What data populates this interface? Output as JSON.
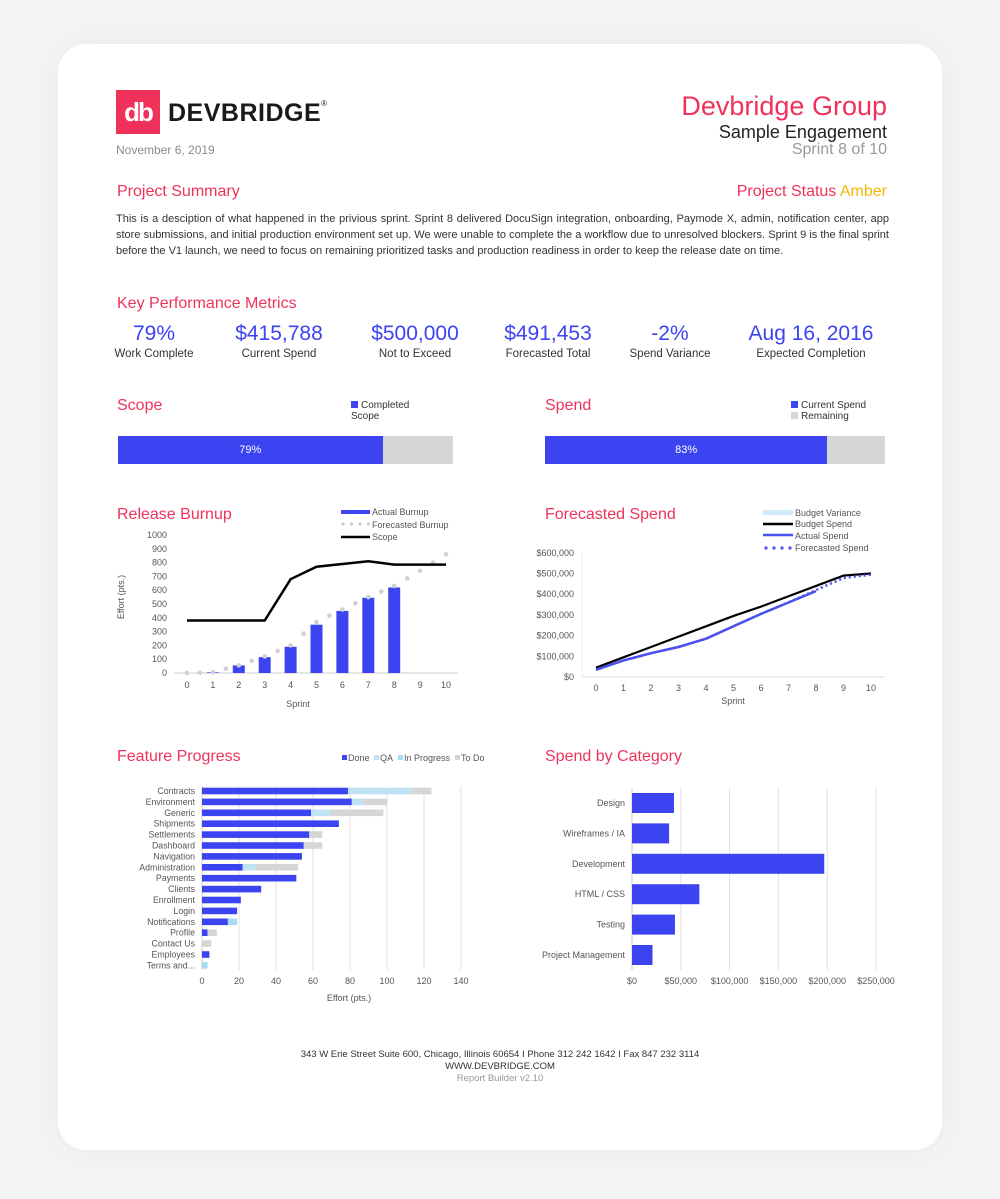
{
  "colors": {
    "brand": "#f0325a",
    "accent": "#3b44f0",
    "status_amber": "#f5b800",
    "remaining": "#d6d6d6",
    "qa": "#bfe3f5",
    "in_progress": "#a6dcf0"
  },
  "header": {
    "logo_mark": "db",
    "logo_text": "DEVBRIDGE",
    "date": "November 6, 2019",
    "company": "Devbridge Group",
    "engagement": "Sample Engagement",
    "sprint": "Sprint 8 of 10"
  },
  "summary": {
    "title": "Project Summary",
    "status_label": "Project Status",
    "status_value": "Amber",
    "text": "This is a desciption of what happened in the privious sprint. Sprint 8 delivered DocuSign integration, onboarding,  Paymode X, admin, notification center, app store submissions, and initial production environment set up. We were unable to complete the a workflow due to unresolved blockers. Sprint 9 is the final sprint before the V1 launch, we need to focus on remaining prioritized tasks and production readiness in order to keep the release date on time."
  },
  "kpi": {
    "title": "Key Performance Metrics",
    "items": [
      {
        "value": "79%",
        "label": "Work Complete"
      },
      {
        "value": "$415,788",
        "label": "Current Spend"
      },
      {
        "value": "$500,000",
        "label": "Not to Exceed"
      },
      {
        "value": "$491,453",
        "label": "Forecasted Total"
      },
      {
        "value": "-2%",
        "label": "Spend Variance"
      },
      {
        "value": "Aug 16, 2016",
        "label": "Expected Completion"
      }
    ]
  },
  "scope": {
    "title": "Scope",
    "legend": [
      "Completed",
      "Scope"
    ],
    "percent": 79,
    "label": "79%"
  },
  "spend": {
    "title": "Spend",
    "legend": [
      "Current Spend",
      "Remaining"
    ],
    "percent": 83,
    "label": "83%"
  },
  "chart_data": [
    {
      "id": "burnup",
      "type": "bar+line",
      "title": "Release Burnup",
      "xlabel": "Sprint",
      "ylabel": "Effort (pts.)",
      "x": [
        0,
        1,
        2,
        3,
        4,
        5,
        6,
        7,
        8,
        9,
        10
      ],
      "ylim": [
        0,
        1000
      ],
      "yticks": [
        0,
        100,
        200,
        300,
        400,
        500,
        600,
        700,
        800,
        900,
        1000
      ],
      "series": [
        {
          "name": "Actual Burnup",
          "kind": "bar",
          "values": [
            0,
            5,
            55,
            115,
            190,
            350,
            450,
            545,
            620,
            null,
            null
          ]
        },
        {
          "name": "Forecasted Burnup",
          "kind": "dotted",
          "values": [
            0,
            5,
            55,
            120,
            200,
            370,
            460,
            550,
            630,
            740,
            860
          ]
        },
        {
          "name": "Scope",
          "kind": "line",
          "values": [
            380,
            380,
            380,
            380,
            680,
            770,
            790,
            810,
            785,
            785,
            785
          ]
        }
      ]
    },
    {
      "id": "forecast",
      "type": "line",
      "title": "Forecasted Spend",
      "xlabel": "Sprint",
      "ylabel": "",
      "x": [
        0,
        1,
        2,
        3,
        4,
        5,
        6,
        7,
        8,
        9,
        10
      ],
      "ylim": [
        0,
        600000
      ],
      "yticks": [
        "$0",
        "$100,000",
        "$200,000",
        "$300,000",
        "$400,000",
        "$500,000",
        "$600,000"
      ],
      "series": [
        {
          "name": "Budget Variance",
          "kind": "area",
          "values": []
        },
        {
          "name": "Budget Spend",
          "kind": "line",
          "values": [
            45000,
            95000,
            145000,
            195000,
            245000,
            295000,
            340000,
            390000,
            440000,
            490000,
            500000
          ]
        },
        {
          "name": "Actual Spend",
          "kind": "line",
          "values": [
            35000,
            80000,
            115000,
            145000,
            185000,
            245000,
            305000,
            360000,
            415000,
            null,
            null
          ]
        },
        {
          "name": "Forecasted Spend",
          "kind": "dotted",
          "values": [
            35000,
            80000,
            115000,
            145000,
            185000,
            245000,
            305000,
            360000,
            420000,
            478000,
            495000
          ]
        }
      ]
    },
    {
      "id": "features",
      "type": "bar",
      "orientation": "horizontal",
      "stacked": true,
      "title": "Feature Progress",
      "xlabel": "Effort (pts.)",
      "xlim": [
        0,
        140
      ],
      "xticks": [
        0,
        20,
        40,
        60,
        80,
        100,
        120,
        140
      ],
      "legend_position": "top-right",
      "categories": [
        "Contracts",
        "Environment",
        "Generic",
        "Shipments",
        "Settlements",
        "Dashboard",
        "Navigation",
        "Administration",
        "Payments",
        "Clients",
        "Enrollment",
        "Login",
        "Notifications",
        "Profile",
        "Contact Us",
        "Employees",
        "Terms and..."
      ],
      "series": [
        {
          "name": "Done",
          "values": [
            79,
            81,
            59,
            74,
            58,
            55,
            54,
            22,
            51,
            32,
            21,
            19,
            14,
            3,
            0,
            4,
            0
          ]
        },
        {
          "name": "QA",
          "values": [
            34,
            6,
            10,
            0,
            0,
            0,
            0,
            7,
            0,
            0,
            0,
            0,
            0,
            0,
            0,
            0,
            0
          ]
        },
        {
          "name": "In Progress",
          "values": [
            0,
            0,
            0,
            0,
            0,
            0,
            0,
            0,
            0,
            0,
            0,
            0,
            5,
            0,
            0,
            0,
            3
          ]
        },
        {
          "name": "To Do",
          "values": [
            11,
            13,
            29,
            0,
            7,
            10,
            0,
            23,
            0,
            0,
            0,
            0,
            0,
            5,
            5,
            0,
            0
          ]
        }
      ]
    },
    {
      "id": "category",
      "type": "bar",
      "orientation": "horizontal",
      "title": "Spend by Category",
      "xlim": [
        0,
        250000
      ],
      "xticks": [
        "$0",
        "$50,000",
        "$100,000",
        "$150,000",
        "$200,000",
        "$250,000"
      ],
      "categories": [
        "Design",
        "Wireframes / IA",
        "Development",
        "HTML / CSS",
        "Testing",
        "Project Management"
      ],
      "values": [
        43000,
        38000,
        197000,
        69000,
        44000,
        21000
      ]
    }
  ],
  "footer": {
    "address": "343 W Erie Street Suite 600, Chicago, Illinois 60654  I  Phone 312 242 1642  I  Fax 847 232 3114",
    "website": "WWW.DEVBRIDGE.COM",
    "version": "Report Builder v2.10"
  }
}
